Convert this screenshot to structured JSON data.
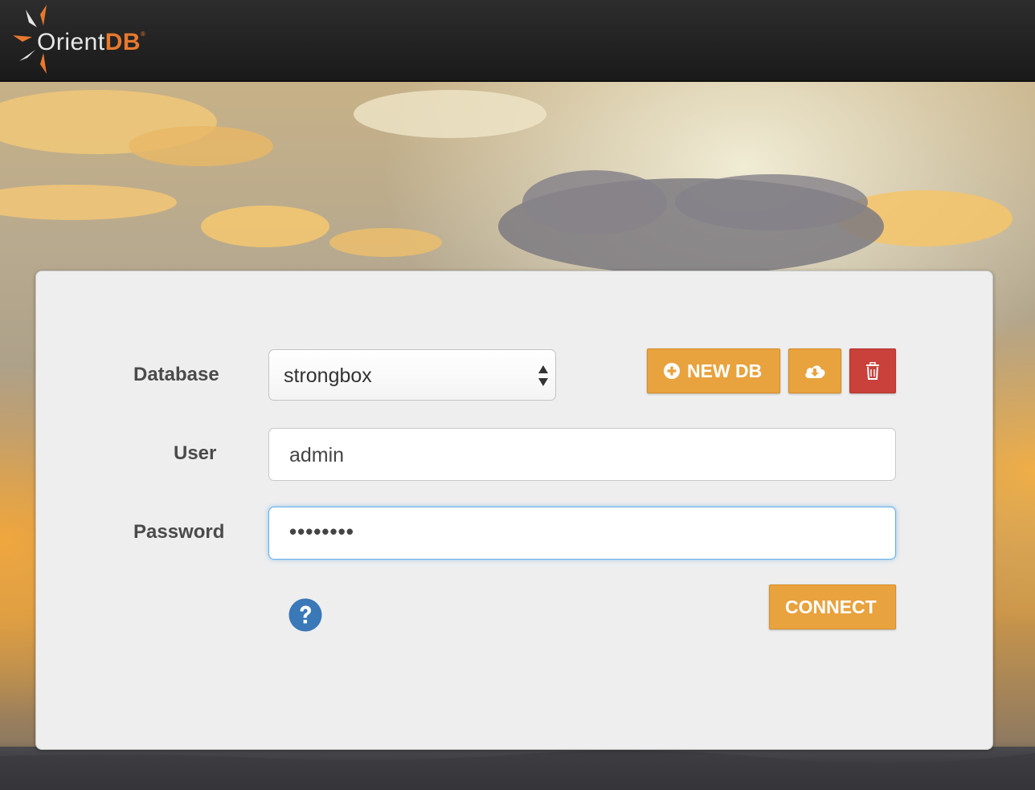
{
  "header": {
    "logo_text_primary": "Orient",
    "logo_text_accent": "DB",
    "logo_registered": "®"
  },
  "login": {
    "database_label": "Database",
    "database_selected": "strongbox",
    "user_label": "User",
    "user_value": "admin",
    "password_label": "Password",
    "password_mask": "••••••••",
    "new_db_label": "NEW DB",
    "connect_label": "CONNECT"
  },
  "icons": {
    "logo": "orientdb-sunburst-icon",
    "new_db": "plus-circle-icon",
    "import": "cloud-download-icon",
    "delete": "trash-icon",
    "help": "question-circle-icon",
    "select_arrows": "sort-arrows-icon"
  },
  "colors": {
    "header_bg": "#1f1f1f",
    "accent_orange": "#e8a23e",
    "danger_red": "#c9413a",
    "focus_blue": "#66afe9",
    "help_blue": "#3a78b8",
    "logo_orange": "#e8792f"
  }
}
